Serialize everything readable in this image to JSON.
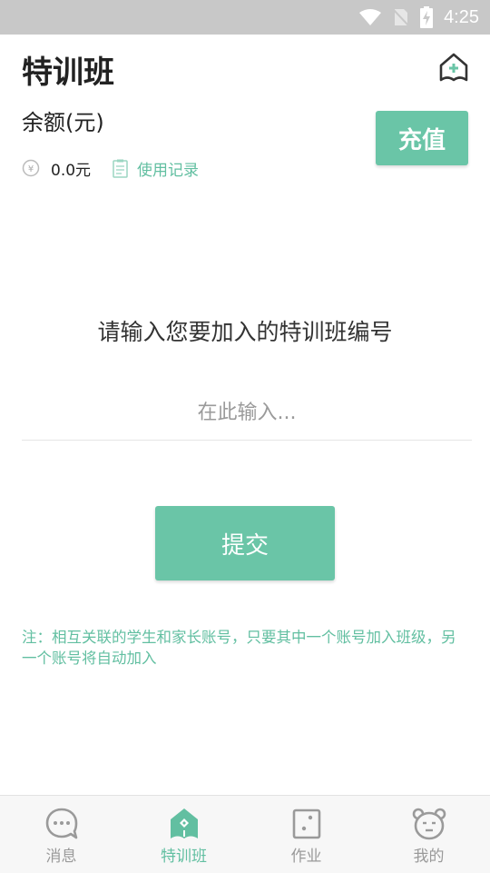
{
  "status_bar": {
    "time": "4:25"
  },
  "header": {
    "title": "特训班",
    "action_icon": "class-add-icon"
  },
  "balance": {
    "label": "余额(元)",
    "value": "0.0元",
    "records_label": "使用记录",
    "recharge_label": "充值"
  },
  "join": {
    "prompt": "请输入您要加入的特训班编号",
    "placeholder": "在此输入...",
    "value": "",
    "submit_label": "提交",
    "note": "注：相互关联的学生和家长账号，只要其中一个账号加入班级，另一个账号将自动加入"
  },
  "tabs": [
    {
      "label": "消息",
      "icon": "message-icon",
      "active": false
    },
    {
      "label": "特训班",
      "icon": "class-icon",
      "active": true
    },
    {
      "label": "作业",
      "icon": "homework-icon",
      "active": false
    },
    {
      "label": "我的",
      "icon": "profile-icon",
      "active": false
    }
  ],
  "colors": {
    "accent": "#6ac5a7",
    "accent_text": "#62bfa1",
    "status_bar": "#c8c8c8"
  }
}
